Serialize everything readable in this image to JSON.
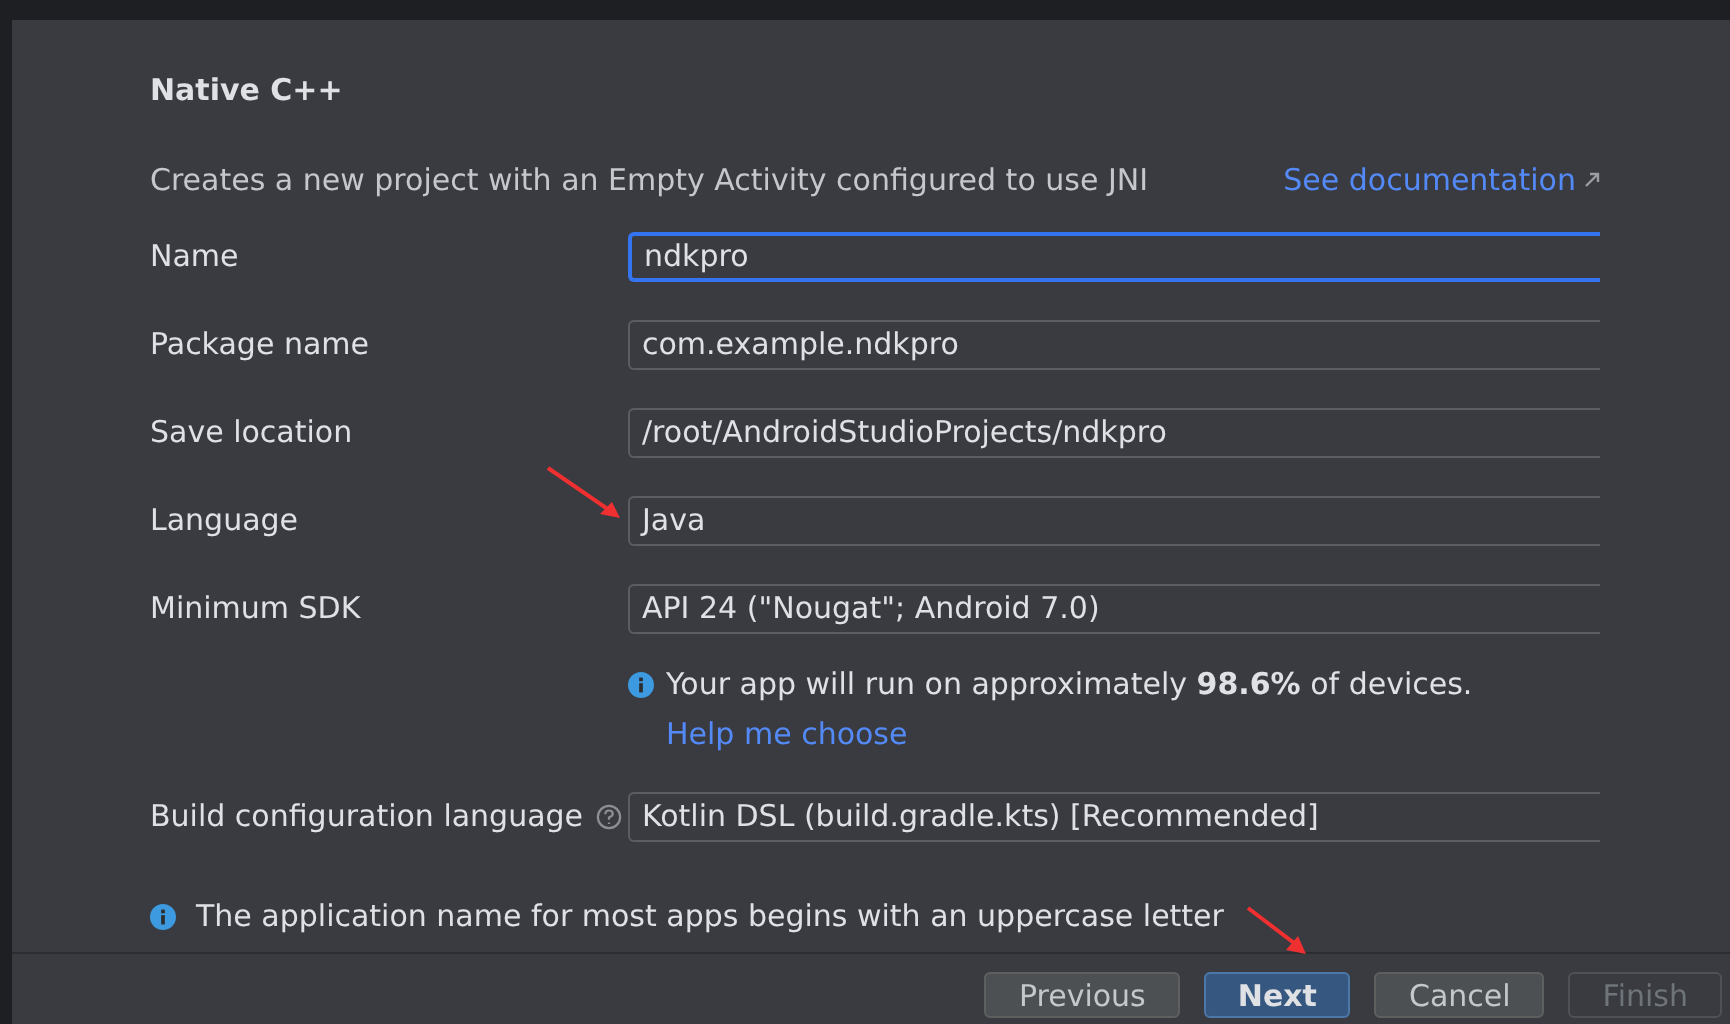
{
  "section_title": "Native C++",
  "description": "Creates a new project with an Empty Activity configured to use JNI",
  "documentation_link": "See documentation",
  "fields": [
    {
      "label": "Name",
      "value": "ndkpro",
      "focused": true
    },
    {
      "label": "Package name",
      "value": "com.example.ndkpro",
      "focused": false
    },
    {
      "label": "Save location",
      "value": "/root/AndroidStudioProjects/ndkpro",
      "focused": false
    },
    {
      "label": "Language",
      "value": "Java",
      "focused": false
    },
    {
      "label": "Minimum SDK",
      "value": "API 24 (\"Nougat\"; Android 7.0)",
      "focused": false
    }
  ],
  "sdk_info": {
    "text": "Your app will run on approximately **98.6%** of devices.",
    "link": "Help me choose"
  },
  "build_config": {
    "label": "Build configuration language",
    "value": "Kotlin DSL (build.gradle.kts) [Recommended]"
  },
  "hint": "The application name for most apps begins with an uppercase letter",
  "buttons": [
    {
      "label": "Previous",
      "default": false,
      "disabled": false
    },
    {
      "label": "Next",
      "default": true,
      "disabled": false
    },
    {
      "label": "Cancel",
      "default": false,
      "disabled": false
    },
    {
      "label": "Finish",
      "default": false,
      "disabled": true
    }
  ]
}
